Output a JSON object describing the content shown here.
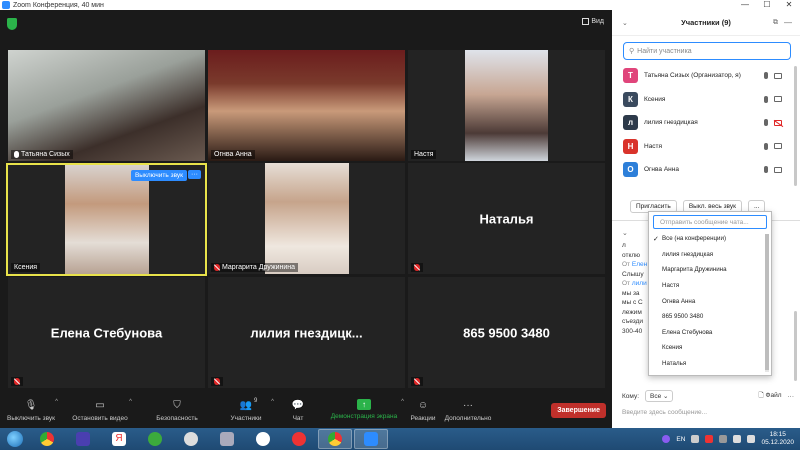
{
  "window": {
    "title": "Zoom Конференция, 40 мин"
  },
  "video": {
    "view_label": "Вид",
    "tiles": [
      {
        "name": "Татьяна Сизых",
        "type": "video"
      },
      {
        "name": "Огнва Анна",
        "type": "video"
      },
      {
        "name": "Настя",
        "type": "video"
      },
      {
        "name": "Ксения",
        "type": "video",
        "active": true
      },
      {
        "name": "Маргарита Дружинина",
        "type": "video"
      },
      {
        "name": "Наталья",
        "type": "name"
      },
      {
        "name": "Елена Стебунова",
        "type": "name"
      },
      {
        "name": "лилия  гнездицк...",
        "type": "name"
      },
      {
        "name": "865 9500 3480",
        "type": "name"
      }
    ],
    "mute_label": "Выключить звук",
    "more_label": "···"
  },
  "toolbar": {
    "mute": "Выключить звук",
    "video": "Остановить видео",
    "security": "Безопасность",
    "participants": "Участники",
    "participants_count": "9",
    "chat": "Чат",
    "share": "Демонстрация экрана",
    "reactions": "Реакции",
    "more": "Дополнительно",
    "end": "Завершение"
  },
  "panel": {
    "title": "Участники (9)",
    "search_placeholder": "Найти участника",
    "participants": [
      {
        "initial": "Т",
        "name": "Татьяна Сизых (Организатор, я)",
        "color": "#e0457b",
        "cam_off": false,
        "mic_off": false
      },
      {
        "initial": "К",
        "name": "Ксения",
        "color": "#3a4a5e",
        "cam_off": false,
        "mic_off": false
      },
      {
        "initial": "л",
        "name": "лилия гнездицкая",
        "color": "#2d3a4a",
        "cam_off": true,
        "mic_off": false
      },
      {
        "initial": "Н",
        "name": "Настя",
        "color": "#d9332b",
        "cam_off": false,
        "mic_off": false
      },
      {
        "initial": "О",
        "name": "Огнва Анна",
        "color": "#2d7fd9",
        "cam_off": false,
        "mic_off": false
      }
    ],
    "invite": "Пригласить",
    "mute_all": "Выкл. весь звук",
    "more": "...",
    "chat": {
      "messages": [
        {
          "text": "л"
        },
        {
          "text": "отклю"
        },
        {
          "from_prefix": "От",
          "from_name": "Елен",
          "text": "Слышу"
        },
        {
          "from_prefix": "От",
          "from_name": "лили",
          "text": "мы за"
        },
        {
          "text": "мы с С"
        },
        {
          "text": "лежим"
        },
        {
          "text": "съезди"
        },
        {
          "text": "300-40"
        }
      ],
      "to_label": "Кому:",
      "to_value": "Все",
      "file_label": "Файл",
      "input_placeholder": "Введите здесь сообщение..."
    },
    "dropdown": {
      "placeholder": "Отправить сообщение чата...",
      "items": [
        {
          "label": "Все (на конференции)",
          "checked": true
        },
        {
          "label": "лилия гнездицкая"
        },
        {
          "label": "Маргарита Дружинина"
        },
        {
          "label": "Настя"
        },
        {
          "label": "Огнва Анна"
        },
        {
          "label": "865 9500 3480"
        },
        {
          "label": "Елена Стебунова"
        },
        {
          "label": "Ксения"
        },
        {
          "label": "Наталья"
        }
      ]
    }
  },
  "taskbar": {
    "lang": "EN",
    "time": "18:15",
    "date": "05.12.2020"
  }
}
